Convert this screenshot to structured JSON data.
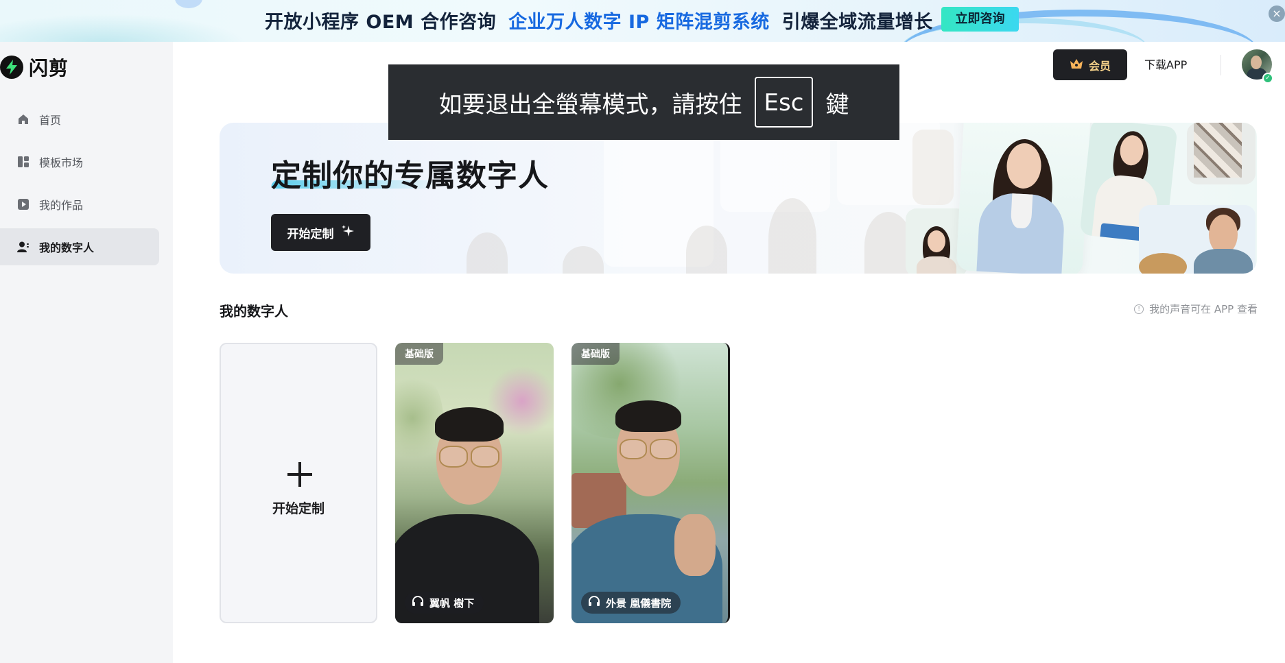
{
  "promo": {
    "part1": "开放小程序 OEM 合作咨询",
    "part2": "企业万人数字 IP 矩阵混剪系统",
    "part3": "引爆全域流量增长",
    "cta": "立即咨询",
    "close": "×"
  },
  "app": {
    "name": "闪剪"
  },
  "sidebar": {
    "items": [
      {
        "label": "首页",
        "icon": "home-icon"
      },
      {
        "label": "模板市场",
        "icon": "grid-icon"
      },
      {
        "label": "我的作品",
        "icon": "play-icon"
      },
      {
        "label": "我的数字人",
        "icon": "digital-human-icon",
        "active": true
      }
    ]
  },
  "header": {
    "vip_label": "会员",
    "download_label": "下载APP"
  },
  "toast": {
    "before": "如要退出全螢幕模式，請按住",
    "key": "Esc",
    "after": "鍵"
  },
  "hero": {
    "title": "定制你的专属数字人",
    "button": "开始定制"
  },
  "section": {
    "title": "我的数字人",
    "hint": "我的声音可在 APP 查看"
  },
  "cards": {
    "add_label": "开始定制",
    "items": [
      {
        "tier": "基础版",
        "voice": "翼帆 樹下"
      },
      {
        "tier": "基础版",
        "voice": "外景 凰儀書院"
      }
    ]
  },
  "colors": {
    "accent_dark": "#1f2024",
    "promo_blue": "#1769e0",
    "promo_cta": "#34e6c3",
    "vip_gold": "#f6d28a"
  }
}
